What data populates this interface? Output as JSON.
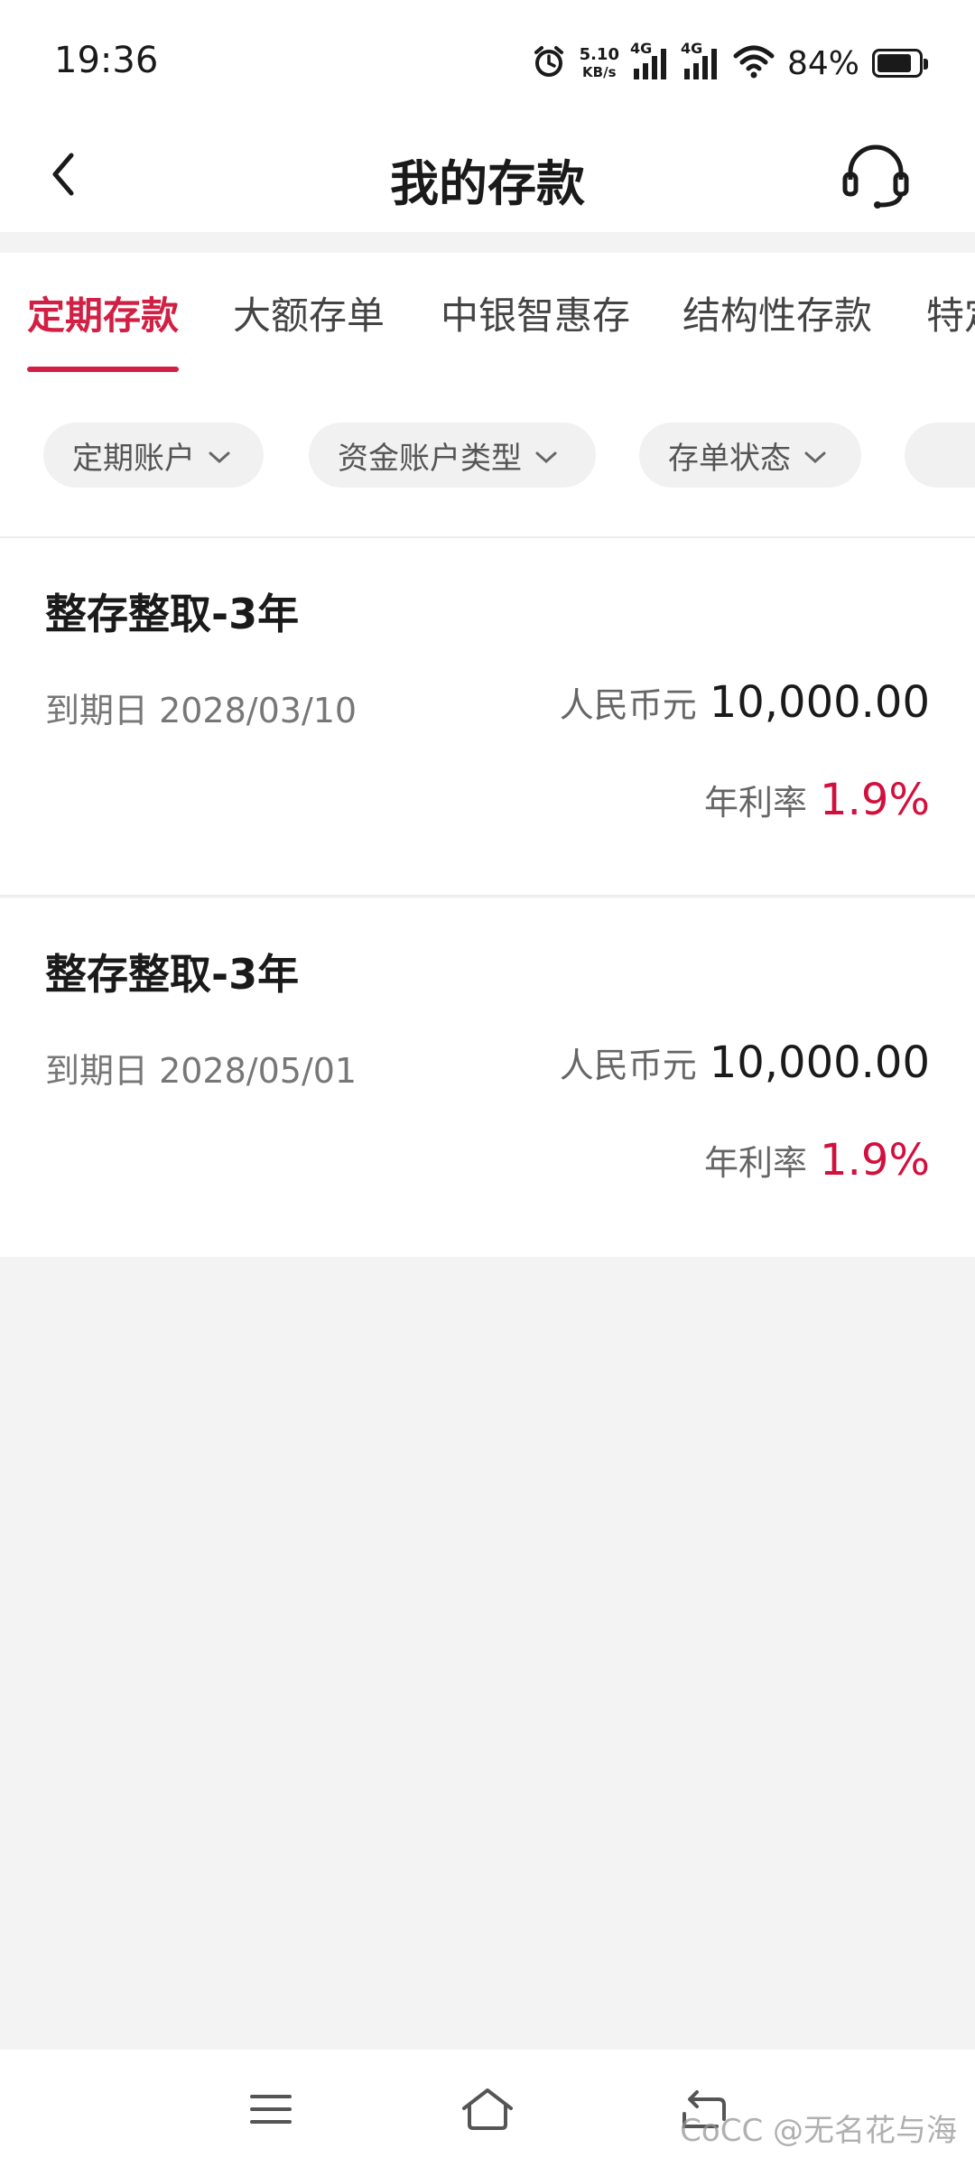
{
  "status_bar": {
    "time": "19:36",
    "net_speed_value": "5.10",
    "net_speed_unit": "KB/s",
    "signal1_label": "4G",
    "signal2_label": "4G",
    "battery_percent": "84%",
    "battery_level": 0.84,
    "icons": [
      "alarm-icon",
      "signal-icon",
      "signal-icon",
      "wifi-icon",
      "battery-icon"
    ]
  },
  "header": {
    "title": "我的存款",
    "back_icon": "chevron-left-icon",
    "service_icon": "headset-icon"
  },
  "tabs": [
    {
      "label": "定期存款",
      "active": true
    },
    {
      "label": "大额存单",
      "active": false
    },
    {
      "label": "中银智惠存",
      "active": false
    },
    {
      "label": "结构性存款",
      "active": false
    },
    {
      "label": "特定",
      "active": false
    }
  ],
  "filters": [
    {
      "label": "定期账户"
    },
    {
      "label": "资金账户类型"
    },
    {
      "label": "存单状态"
    }
  ],
  "deposits": [
    {
      "title": "整存整取-3年",
      "maturity": "到期日 2028/03/10",
      "currency": "人民币元",
      "amount": "10,000.00",
      "rate_label": "年利率",
      "rate": "1.9%"
    },
    {
      "title": "整存整取-3年",
      "maturity": "到期日 2028/05/01",
      "currency": "人民币元",
      "amount": "10,000.00",
      "rate_label": "年利率",
      "rate": "1.9%"
    }
  ],
  "bottom_nav": {
    "icons": [
      "menu-icon",
      "home-icon",
      "back-icon"
    ],
    "watermark": "CoCC @无名花与海"
  },
  "colors": {
    "accent": "#d21f44",
    "rate": "#d2103e",
    "background": "#f3f3f3"
  }
}
